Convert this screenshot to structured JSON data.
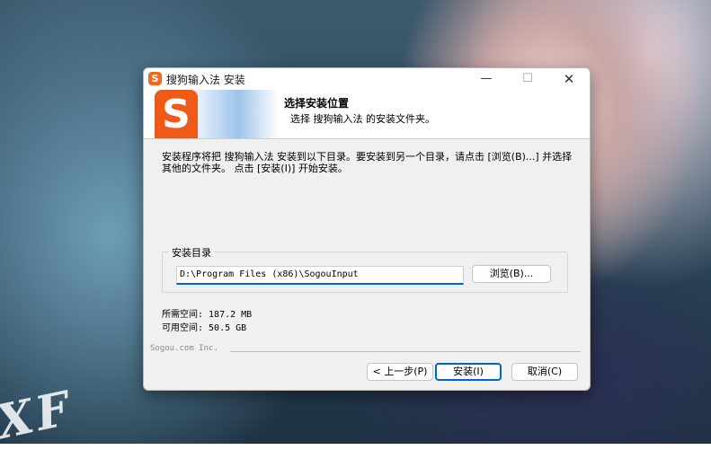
{
  "wallpaper": {
    "logo_text": "XF"
  },
  "window": {
    "title": "搜狗输入法 安装",
    "app_icon_glyph": "S",
    "controls": {
      "minimize": "—",
      "maximize": "☐",
      "close": "✕"
    }
  },
  "header": {
    "logo_glyph": "S",
    "title": "选择安装位置",
    "subtitle": "选择 搜狗输入法 的安装文件夹。"
  },
  "body": {
    "description": "安装程序将把 搜狗输入法 安装到以下目录。要安装到另一个目录，请点击 [浏览(B)...] 并选择其他的文件夹。 点击 [安装(I)] 开始安装。",
    "group_label": "安装目录",
    "install_path": "D:\\Program Files (x86)\\SogouInput",
    "browse_label": "浏览(B)...",
    "space_required": "所需空间: 187.2 MB",
    "space_available": "可用空间: 50.5 GB"
  },
  "footer": {
    "brand": "Sogou.com Inc.",
    "back_label": "< 上一步(P)",
    "install_label": "安装(I)",
    "cancel_label": "取消(C)"
  },
  "colors": {
    "accent": "#0067c0",
    "logo_orange": "#f05a18"
  }
}
